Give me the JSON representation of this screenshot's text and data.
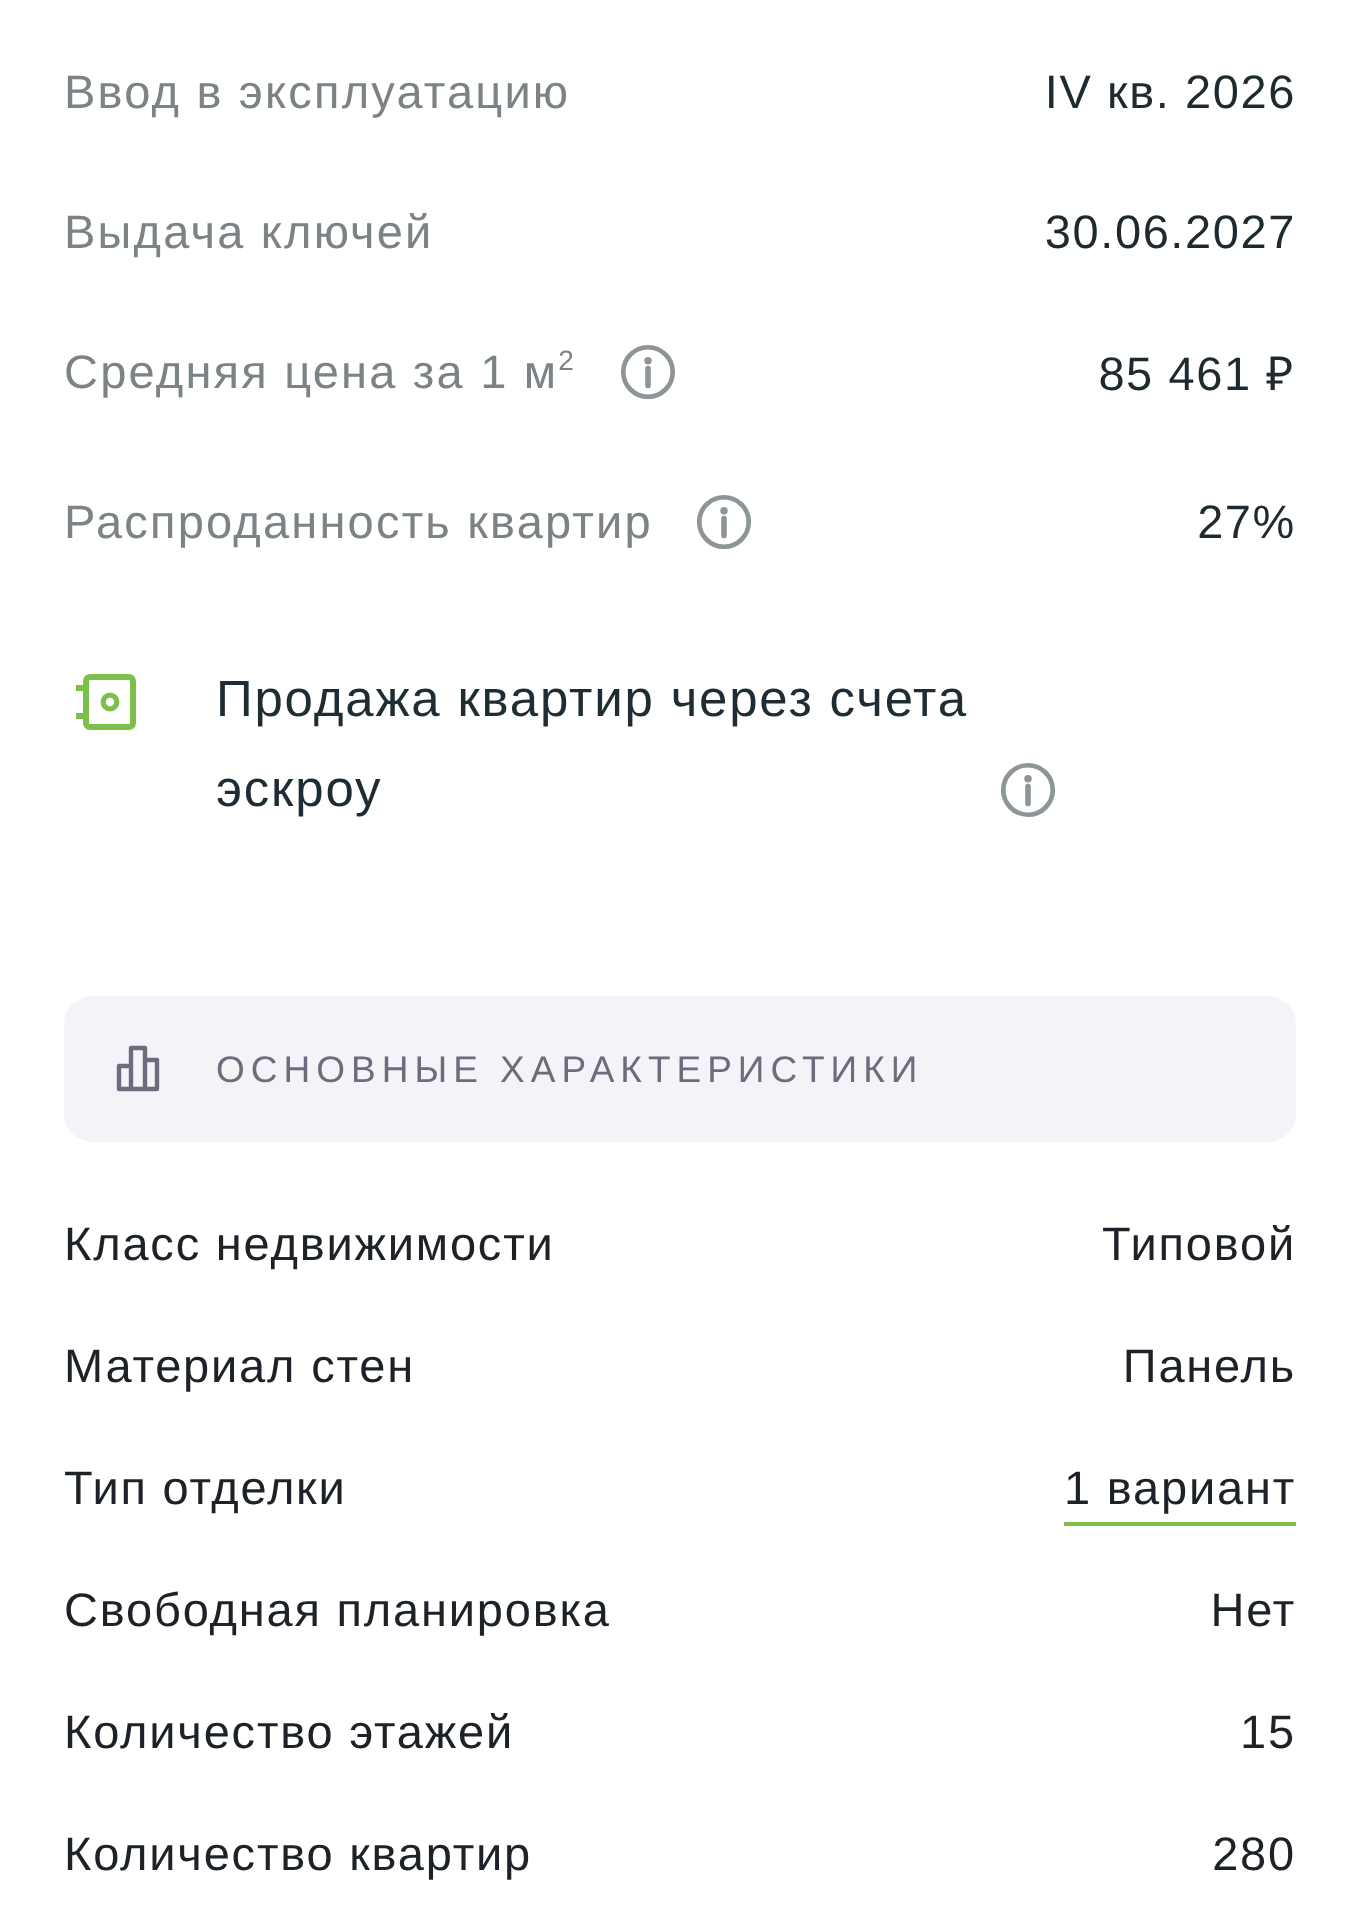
{
  "summary": [
    {
      "label": "Ввод в эксплуатацию",
      "value": "IV кв. 2026"
    },
    {
      "label": "Выдача ключей",
      "value": "30.06.2027"
    },
    {
      "label": "Средняя цена за 1 м$^{2}$",
      "value": "85 461 ₽",
      "info": true
    },
    {
      "label": "Распроданность квартир",
      "value": "27%",
      "info": true
    }
  ],
  "escrow": {
    "text": "Продажа квартир через счета эскроу",
    "info": true
  },
  "section": {
    "title": "ОСНОВНЫЕ ХАРАКТЕРИСТИКИ"
  },
  "characteristics": [
    {
      "label": "Класс недвижимости",
      "value": "Типовой",
      "link": false
    },
    {
      "label": "Материал стен",
      "value": "Панель",
      "link": false
    },
    {
      "label": "Тип отделки",
      "value": "1 вариант",
      "link": true
    },
    {
      "label": "Свободная планировка",
      "value": "Нет",
      "link": false
    },
    {
      "label": "Количество этажей",
      "value": "15",
      "link": false
    },
    {
      "label": "Количество квартир",
      "value": "280",
      "link": false
    }
  ]
}
